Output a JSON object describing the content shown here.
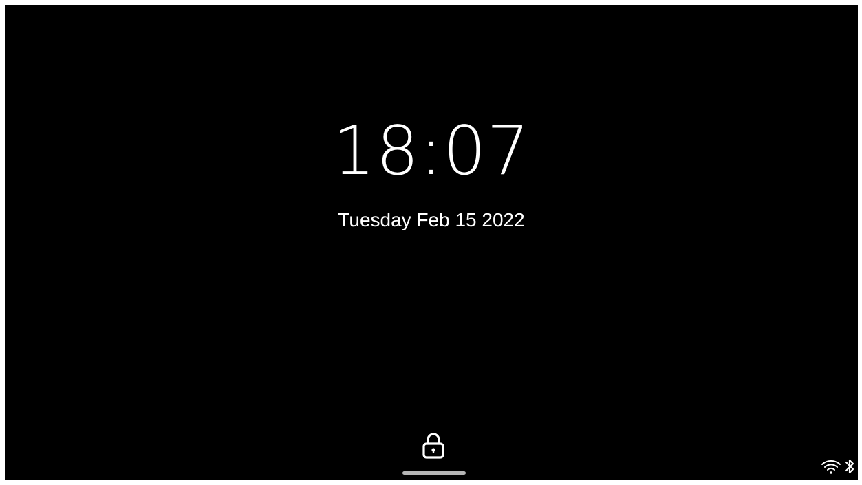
{
  "lockscreen": {
    "time": "18:07",
    "date": "Tuesday Feb 15 2022"
  },
  "icons": {
    "unlock": "lock-icon",
    "wifi": "wifi-icon",
    "bluetooth": "bluetooth-icon"
  },
  "colors": {
    "background": "#000000",
    "foreground": "#ffffff",
    "handle": "#b5b5b5"
  }
}
